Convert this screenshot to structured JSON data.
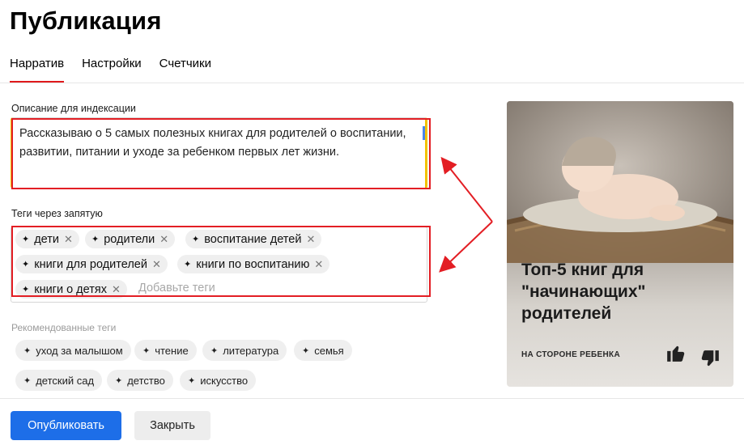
{
  "page": {
    "title": "Публикация"
  },
  "tabs": [
    {
      "label": "Нарратив",
      "active": true
    },
    {
      "label": "Настройки",
      "active": false
    },
    {
      "label": "Счетчики",
      "active": false
    }
  ],
  "description": {
    "label": "Описание для индексации",
    "value": "Рассказываю о 5 самых полезных книгах для родителей о воспитании, развитии, питании и уходе за ребенком первых лет жизни."
  },
  "tags": {
    "label": "Теги через запятую",
    "items": [
      "дети",
      "родители",
      "воспитание детей",
      "книги для родителей",
      "книги по воспитанию",
      "книги о детях"
    ],
    "placeholder": "Добавьте теги"
  },
  "recommended": {
    "label": "Рекомендованные теги",
    "items": [
      "уход за малышом",
      "чтение",
      "литература",
      "семья",
      "детский сад",
      "детство",
      "искусство"
    ]
  },
  "buttons": {
    "publish": "Опубликовать",
    "close": "Закрыть"
  },
  "card": {
    "title": "Топ-5 книг для \"начинающих\" родителей",
    "source": "НА СТОРОНЕ РЕБЕНКА",
    "image_subject": "sleeping baby in a basket"
  },
  "icons": {
    "tag": "sparkle-icon",
    "remove": "close-icon",
    "like": "thumbs-up-icon",
    "dislike": "thumbs-down-icon"
  },
  "colors": {
    "accent": "#e0191c",
    "primary_button": "#1d6ee8",
    "annotation": "#e31e24",
    "focus_border": "#f2c200"
  }
}
